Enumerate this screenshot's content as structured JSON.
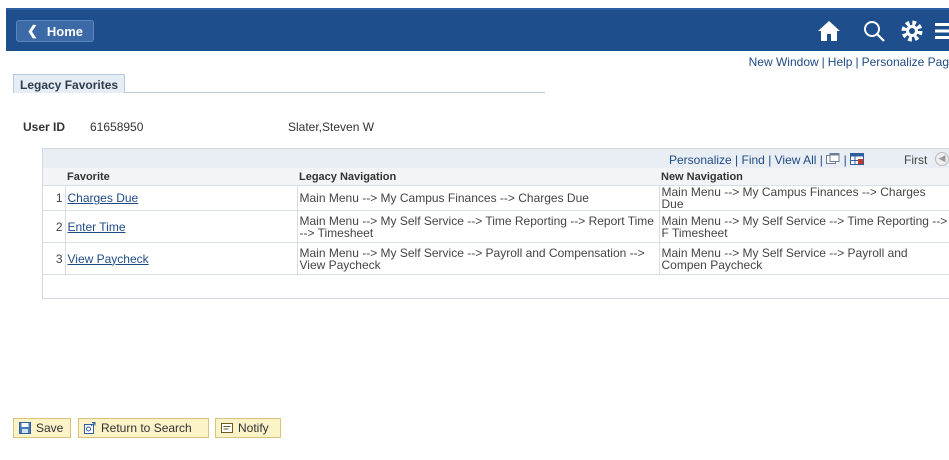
{
  "header": {
    "home_label": "Home",
    "links": [
      "New Window",
      "Help",
      "Personalize Pag"
    ]
  },
  "tab": {
    "label": "Legacy Favorites"
  },
  "user": {
    "label": "User ID",
    "id": "61658950",
    "name": "Slater,Steven W"
  },
  "grid": {
    "toolbar": {
      "personalize": "Personalize",
      "find": "Find",
      "view_all": "View All",
      "first": "First"
    },
    "columns": [
      "Favorite",
      "Legacy Navigation",
      "New Navigation"
    ],
    "rows": [
      {
        "num": "1",
        "favorite": "Charges Due",
        "legacy": "Main Menu --> My Campus Finances --> Charges Due",
        "new": "Main Menu --> My Campus Finances --> Charges Due"
      },
      {
        "num": "2",
        "favorite": "Enter Time",
        "legacy": "Main Menu --> My Self Service --> Time Reporting --> Report Time --> Timesheet",
        "new": "Main Menu --> My Self Service --> Time Reporting --> F Timesheet"
      },
      {
        "num": "3",
        "favorite": "View Paycheck",
        "legacy": "Main Menu --> My Self Service --> Payroll and Compensation --> View Paycheck",
        "new": "Main Menu --> My Self Service --> Payroll and Compen Paycheck"
      }
    ]
  },
  "buttons": {
    "save": "Save",
    "return_to_search": "Return to Search",
    "notify": "Notify"
  }
}
